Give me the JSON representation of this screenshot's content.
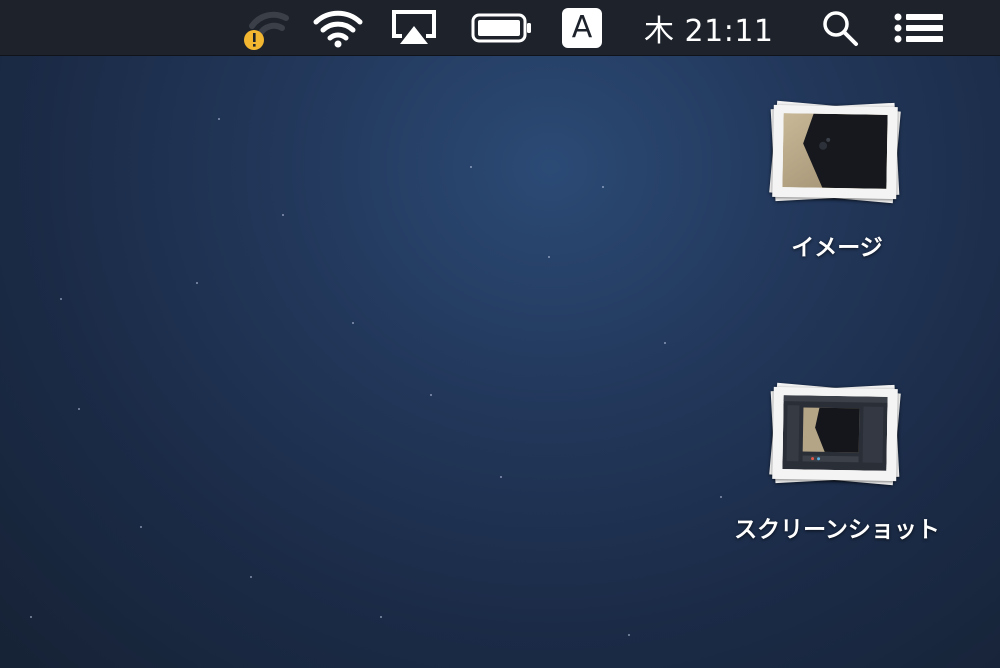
{
  "menubar": {
    "status_icons": [
      "wifi-signal-warning-icon",
      "wifi-icon",
      "airplay-icon",
      "battery-icon"
    ],
    "input_source": "A",
    "clock": "木 21:11",
    "right_icons": [
      "spotlight-search-icon",
      "notification-center-icon"
    ],
    "colors": {
      "bar": "#1d222b",
      "warning": "#f2b630"
    }
  },
  "desktop": {
    "icons": [
      {
        "label": "イメージ",
        "icon": "photo-stack-icon"
      },
      {
        "label": "スクリーンショット",
        "icon": "photo-stack-icon"
      }
    ]
  }
}
